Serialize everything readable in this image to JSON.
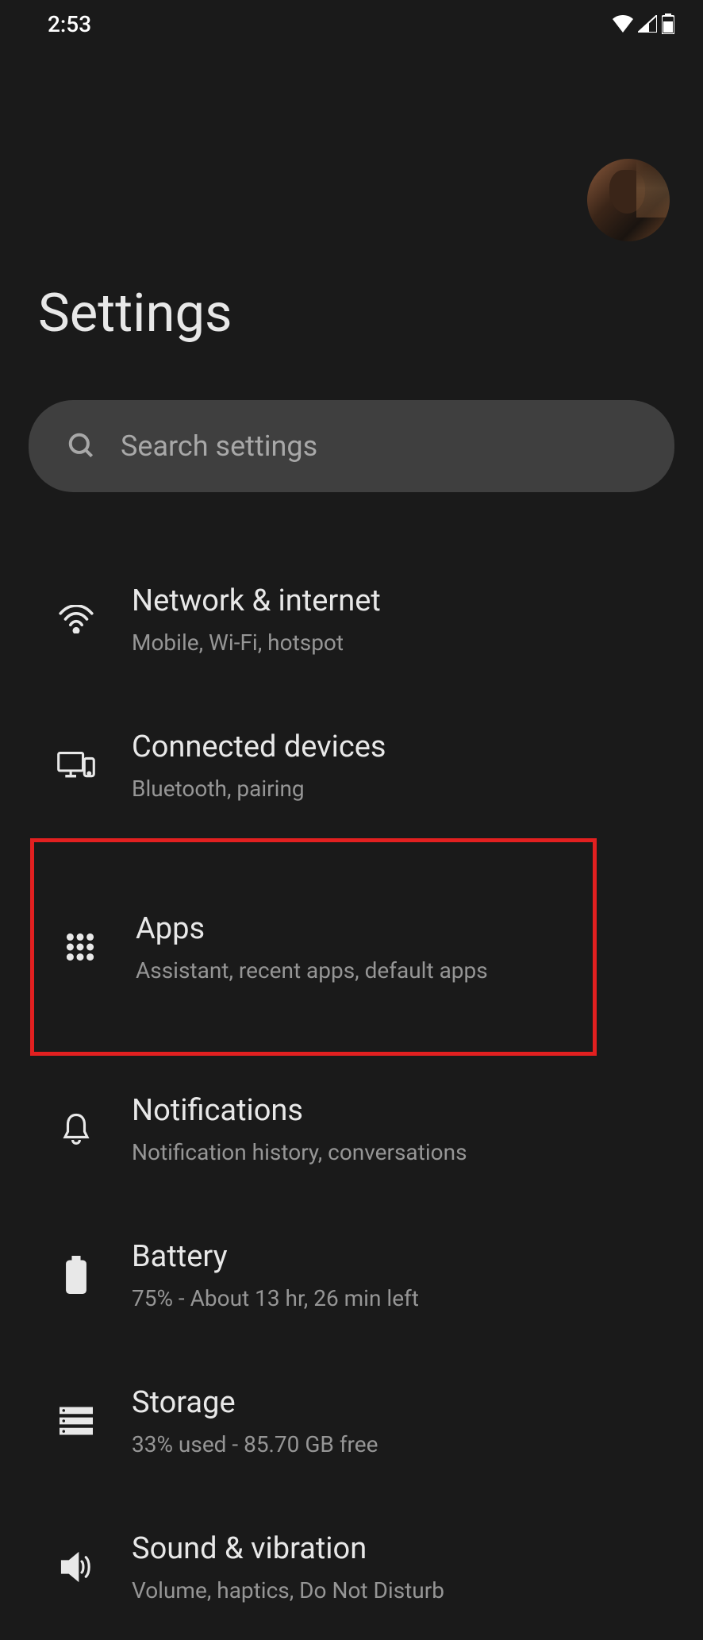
{
  "status_bar": {
    "time": "2:53"
  },
  "page": {
    "title": "Settings"
  },
  "search": {
    "placeholder": "Search settings"
  },
  "items": [
    {
      "title": "Network & internet",
      "subtitle": "Mobile, Wi-Fi, hotspot",
      "icon": "wifi-icon"
    },
    {
      "title": "Connected devices",
      "subtitle": "Bluetooth, pairing",
      "icon": "devices-icon"
    },
    {
      "title": "Apps",
      "subtitle": "Assistant, recent apps, default apps",
      "icon": "apps-icon",
      "highlighted": true
    },
    {
      "title": "Notifications",
      "subtitle": "Notification history, conversations",
      "icon": "bell-icon"
    },
    {
      "title": "Battery",
      "subtitle": "75% - About 13 hr, 26 min left",
      "icon": "battery-icon"
    },
    {
      "title": "Storage",
      "subtitle": "33% used - 85.70 GB free",
      "icon": "storage-icon"
    },
    {
      "title": "Sound & vibration",
      "subtitle": "Volume, haptics, Do Not Disturb",
      "icon": "sound-icon"
    }
  ]
}
